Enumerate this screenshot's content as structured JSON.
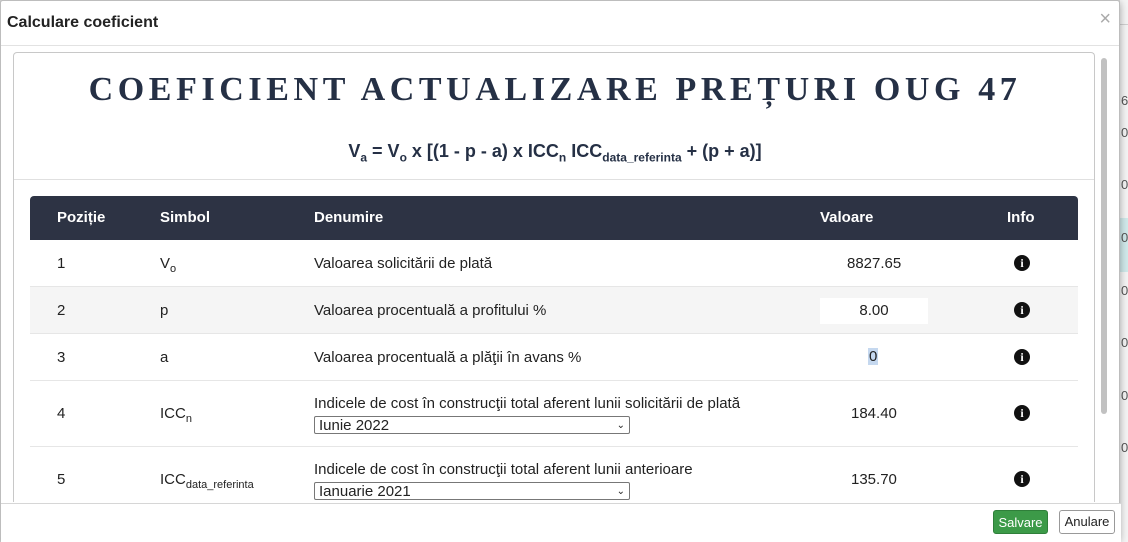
{
  "dialog": {
    "title": "Calculare coeficient",
    "close_symbol": "×"
  },
  "heading": "COEFICIENT ACTUALIZARE PREȚURI OUG 47",
  "formula": {
    "va": "V",
    "va_sub": "a",
    "eq": " = V",
    "vo_sub": "o",
    "mid": " x [(1 - p - a) x ICC",
    "n_sub": "n",
    "icc2": " ICC",
    "ref_sub": "data_referinta",
    "end": " + (p + a)]"
  },
  "table": {
    "headers": [
      "Poziție",
      "Simbol",
      "Denumire",
      "Valoare",
      "Info"
    ],
    "rows": [
      {
        "pos": "1",
        "symbol": "V",
        "symbol_sub": "o",
        "name": "Valoarea solicitării de plată",
        "value": "8827.65"
      },
      {
        "pos": "2",
        "symbol": "p",
        "symbol_sub": "",
        "name": "Valoarea procentuală a profitului %",
        "value": "8.00"
      },
      {
        "pos": "3",
        "symbol": "a",
        "symbol_sub": "",
        "name": "Valoarea procentuală a plăţii în avans %",
        "value": "0"
      },
      {
        "pos": "4",
        "symbol": "ICC",
        "symbol_sub": "n",
        "name": "Indicele de cost în construcţii total aferent lunii solicitării de plată",
        "select": "Iunie 2022",
        "value": "184.40"
      },
      {
        "pos": "5",
        "symbol": "ICC",
        "symbol_sub": "data_referinta",
        "name": "Indicele de cost în construcţii total aferent lunii anterioare",
        "select": "Ianuarie 2021",
        "value": "135.70"
      }
    ]
  },
  "icons": {
    "info": "info-icon",
    "close": "close-icon",
    "dropdown": "chevron-down-icon"
  },
  "footer": {
    "save_label": "Salvare",
    "cancel_label": "Anulare"
  },
  "background_glyphs": [
    "6",
    "0",
    "0",
    "0",
    "0",
    "0",
    "0",
    "0"
  ],
  "colors": {
    "header_bg": "#2d3344",
    "heading": "#253045",
    "save": "#3c9a48",
    "highlight": "#c5d8ef"
  }
}
